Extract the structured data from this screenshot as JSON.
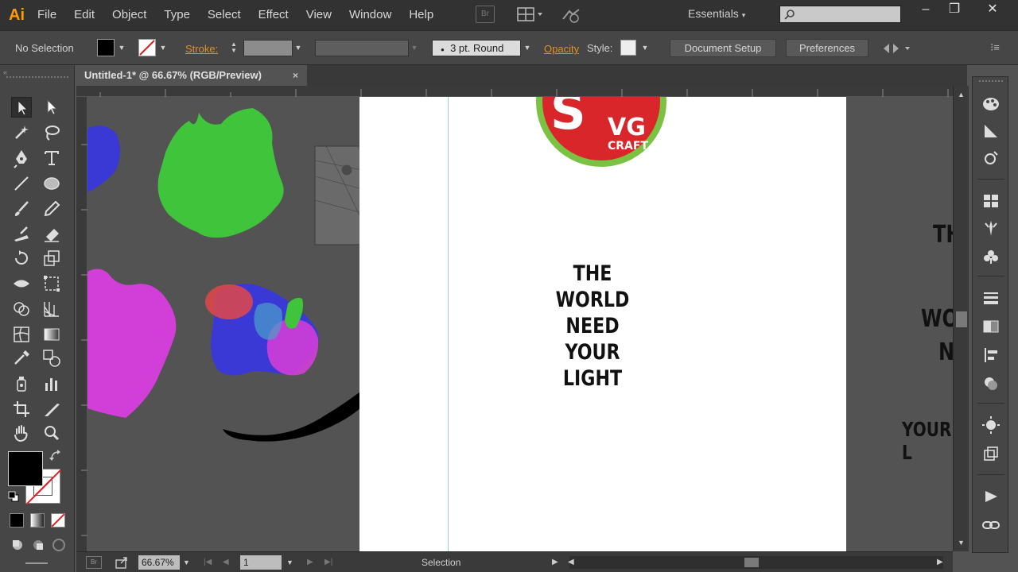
{
  "app": {
    "logo": "Ai",
    "menu": [
      "File",
      "Edit",
      "Object",
      "Type",
      "Select",
      "Effect",
      "View",
      "Window",
      "Help"
    ],
    "bridge_label": "Br",
    "workspace": "Essentials",
    "search_placeholder": ""
  },
  "window_controls": {
    "minimize": "–",
    "restore": "❐",
    "close": "✕"
  },
  "control_bar": {
    "selection": "No Selection",
    "stroke_label": "Stroke:",
    "brush": "3 pt. Round",
    "opacity_label": "Opacity",
    "style_label": "Style:",
    "document_setup": "Document Setup",
    "preferences": "Preferences"
  },
  "document_tab": {
    "title": "Untitled-1* @ 66.67% (RGB/Preview)",
    "close": "×"
  },
  "artboard": {
    "logo_text_main": "VG",
    "logo_text_sub": "CRAFT",
    "logo_letter": "S",
    "headline": [
      "THE",
      "WORLD",
      "NEED",
      "YOUR LIGHT"
    ],
    "side_text": {
      "t1": "TH",
      "t2": "WO",
      "t3": "N",
      "t4": "YOUR L"
    }
  },
  "status_bar": {
    "zoom": "66.67%",
    "page": "1",
    "tool": "Selection"
  },
  "colors": {
    "ui_bg": "#535353",
    "panel": "#464646",
    "menubar": "#323232",
    "accent": "#e1921f",
    "blob_green": "#3fc43b",
    "blob_magenta": "#d23ed8",
    "blob_blue": "#3b39d6",
    "logo_red": "#d9262b",
    "logo_green": "#7bc142"
  }
}
